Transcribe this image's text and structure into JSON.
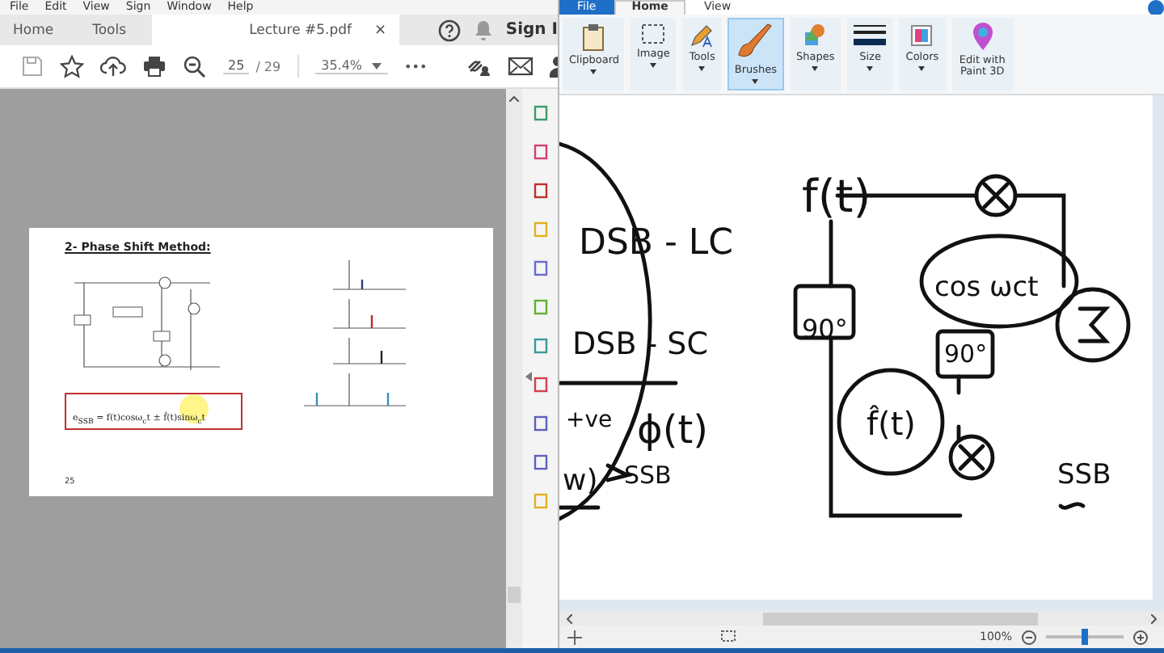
{
  "acrobat": {
    "menu": [
      "File",
      "Edit",
      "View",
      "Sign",
      "Window",
      "Help"
    ],
    "tabs": [
      {
        "label": "Home",
        "selected": false
      },
      {
        "label": "Tools",
        "selected": false
      },
      {
        "label": "Lecture #5.pdf",
        "selected": true
      }
    ],
    "close_tab": "×",
    "sign_in": "Sign I",
    "page_current": "25",
    "page_total": "/ 29",
    "zoom": "35.4%",
    "more": "•••",
    "page": {
      "heading": "2- Phase Shift Method:",
      "formula": "e$_{SSB}$ = f(t)cosω$_{c}$t ± f̂(t)sinω$_{c}$t",
      "page_number": "25"
    }
  },
  "paint": {
    "tabs": [
      {
        "label": "File",
        "kind": "file",
        "selected": false
      },
      {
        "label": "Home",
        "kind": "tab",
        "selected": true
      },
      {
        "label": "View",
        "kind": "tab",
        "selected": false
      }
    ],
    "groups": [
      {
        "label": "Clipboard",
        "kind": "clipboard",
        "dropdown": true,
        "selected": false
      },
      {
        "label": "Image",
        "kind": "image",
        "dropdown": true,
        "selected": false
      },
      {
        "label": "Tools",
        "kind": "tools",
        "dropdown": true,
        "selected": false
      },
      {
        "label": "Brushes",
        "kind": "brushes",
        "dropdown": true,
        "selected": true
      },
      {
        "label": "Shapes",
        "kind": "shapes",
        "dropdown": true,
        "selected": false
      },
      {
        "label": "Size",
        "kind": "size",
        "dropdown": true,
        "selected": false
      },
      {
        "label": "Colors",
        "kind": "colors",
        "dropdown": true,
        "selected": false
      },
      {
        "label": "Edit with Paint 3D",
        "kind": "paint3d",
        "dropdown": false,
        "selected": false
      }
    ],
    "sketch_labels": [
      "f(t)",
      "DSB - LC",
      "cos ωct",
      "90°",
      "DSB - SC",
      "90°",
      "+ve",
      "ϕ(t)",
      "f̂(t)",
      "w)",
      "SSB",
      "SSB"
    ],
    "zoom": "100%",
    "level": 0.5
  }
}
